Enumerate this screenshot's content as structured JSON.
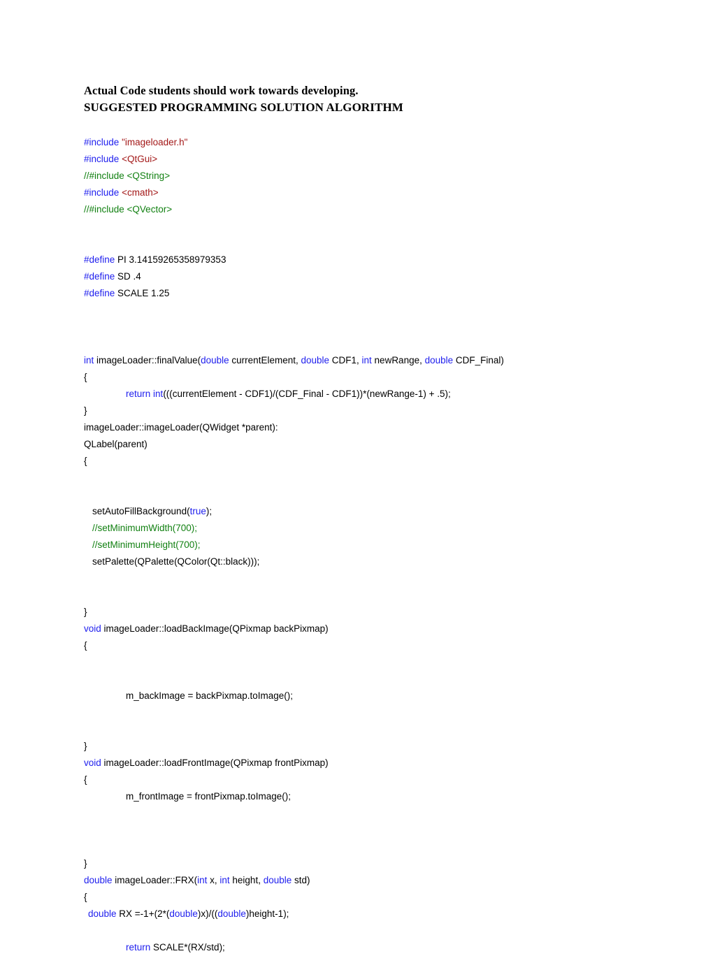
{
  "document": {
    "headings": [
      "Actual Code students should work towards developing.",
      "SUGGESTED PROGRAMMING SOLUTION ALGORITHM"
    ]
  },
  "colors": {
    "keyword": "#2020EE",
    "preprocessor": "#2020EE",
    "string": "#A31818",
    "comment": "#118011",
    "plain": "#000000",
    "background": "#FFFFFF"
  },
  "code": {
    "language": "cpp",
    "lines": [
      {
        "indent": "none",
        "tokens": [
          {
            "t": "#include",
            "c": "pp"
          },
          {
            "t": " ",
            "c": "pl"
          },
          {
            "t": "\"imageloader.h\"",
            "c": "str"
          }
        ]
      },
      {
        "indent": "none",
        "tokens": [
          {
            "t": "#include",
            "c": "pp"
          },
          {
            "t": " ",
            "c": "pl"
          },
          {
            "t": "<QtGui>",
            "c": "str"
          }
        ]
      },
      {
        "indent": "none",
        "tokens": [
          {
            "t": "//#include <QString>",
            "c": "cmt"
          }
        ]
      },
      {
        "indent": "none",
        "tokens": [
          {
            "t": "#include",
            "c": "pp"
          },
          {
            "t": " ",
            "c": "pl"
          },
          {
            "t": "<cmath>",
            "c": "str"
          }
        ]
      },
      {
        "indent": "none",
        "tokens": [
          {
            "t": "//#include <QVector>",
            "c": "cmt"
          }
        ]
      },
      {
        "indent": "none",
        "tokens": []
      },
      {
        "indent": "none",
        "tokens": []
      },
      {
        "indent": "none",
        "tokens": [
          {
            "t": "#define",
            "c": "pp"
          },
          {
            "t": " PI 3.14159265358979353",
            "c": "pl"
          }
        ]
      },
      {
        "indent": "none",
        "tokens": [
          {
            "t": "#define",
            "c": "pp"
          },
          {
            "t": " SD .4",
            "c": "pl"
          }
        ]
      },
      {
        "indent": "none",
        "tokens": [
          {
            "t": "#define",
            "c": "pp"
          },
          {
            "t": " SCALE 1.25",
            "c": "pl"
          }
        ]
      },
      {
        "indent": "none",
        "tokens": []
      },
      {
        "indent": "none",
        "tokens": []
      },
      {
        "indent": "none",
        "tokens": []
      },
      {
        "indent": "none",
        "tokens": [
          {
            "t": "int",
            "c": "kw"
          },
          {
            "t": " imageLoader::finalValue(",
            "c": "pl"
          },
          {
            "t": "double",
            "c": "kw"
          },
          {
            "t": " currentElement, ",
            "c": "pl"
          },
          {
            "t": "double",
            "c": "kw"
          },
          {
            "t": " CDF1, ",
            "c": "pl"
          },
          {
            "t": "int",
            "c": "kw"
          },
          {
            "t": " newRange, ",
            "c": "pl"
          },
          {
            "t": "double",
            "c": "kw"
          },
          {
            "t": " CDF_Final)",
            "c": "pl"
          }
        ]
      },
      {
        "indent": "none",
        "tokens": [
          {
            "t": "{",
            "c": "pl"
          }
        ]
      },
      {
        "indent": "tab",
        "tokens": [
          {
            "t": "return",
            "c": "kw"
          },
          {
            "t": " ",
            "c": "pl"
          },
          {
            "t": "int",
            "c": "kw"
          },
          {
            "t": "(((currentElement - CDF1)/(CDF_Final - CDF1))*(newRange-1) + .5);",
            "c": "pl"
          }
        ]
      },
      {
        "indent": "none",
        "tokens": [
          {
            "t": "}",
            "c": "pl"
          }
        ]
      },
      {
        "indent": "none",
        "tokens": [
          {
            "t": "imageLoader::imageLoader(QWidget *parent):",
            "c": "pl"
          }
        ]
      },
      {
        "indent": "none",
        "tokens": [
          {
            "t": "QLabel(parent)",
            "c": "pl"
          }
        ]
      },
      {
        "indent": "none",
        "tokens": [
          {
            "t": "{",
            "c": "pl"
          }
        ]
      },
      {
        "indent": "none",
        "tokens": []
      },
      {
        "indent": "none",
        "tokens": []
      },
      {
        "indent": "small",
        "tokens": [
          {
            "t": "setAutoFillBackground(",
            "c": "pl"
          },
          {
            "t": "true",
            "c": "kw"
          },
          {
            "t": ");",
            "c": "pl"
          }
        ]
      },
      {
        "indent": "small",
        "tokens": [
          {
            "t": "//setMinimumWidth(700);",
            "c": "cmt"
          }
        ]
      },
      {
        "indent": "small",
        "tokens": [
          {
            "t": "//setMinimumHeight(700);",
            "c": "cmt"
          }
        ]
      },
      {
        "indent": "small",
        "tokens": [
          {
            "t": "setPalette(QPalette(QColor(Qt::black)));",
            "c": "pl"
          }
        ]
      },
      {
        "indent": "none",
        "tokens": []
      },
      {
        "indent": "none",
        "tokens": []
      },
      {
        "indent": "none",
        "tokens": [
          {
            "t": "}",
            "c": "pl"
          }
        ]
      },
      {
        "indent": "none",
        "tokens": [
          {
            "t": "void",
            "c": "kw"
          },
          {
            "t": " imageLoader::loadBackImage(QPixmap backPixmap)",
            "c": "pl"
          }
        ]
      },
      {
        "indent": "none",
        "tokens": [
          {
            "t": "{",
            "c": "pl"
          }
        ]
      },
      {
        "indent": "none",
        "tokens": []
      },
      {
        "indent": "none",
        "tokens": []
      },
      {
        "indent": "tab",
        "tokens": [
          {
            "t": "m_backImage = backPixmap.toImage();",
            "c": "pl"
          }
        ]
      },
      {
        "indent": "none",
        "tokens": []
      },
      {
        "indent": "none",
        "tokens": []
      },
      {
        "indent": "none",
        "tokens": [
          {
            "t": "}",
            "c": "pl"
          }
        ]
      },
      {
        "indent": "none",
        "tokens": [
          {
            "t": "void",
            "c": "kw"
          },
          {
            "t": " imageLoader::loadFrontImage(QPixmap frontPixmap)",
            "c": "pl"
          }
        ]
      },
      {
        "indent": "none",
        "tokens": [
          {
            "t": "{",
            "c": "pl"
          }
        ]
      },
      {
        "indent": "tab",
        "tokens": [
          {
            "t": "m_frontImage = frontPixmap.toImage();",
            "c": "pl"
          }
        ]
      },
      {
        "indent": "none",
        "tokens": []
      },
      {
        "indent": "none",
        "tokens": []
      },
      {
        "indent": "none",
        "tokens": []
      },
      {
        "indent": "none",
        "tokens": [
          {
            "t": "}",
            "c": "pl"
          }
        ]
      },
      {
        "indent": "none",
        "tokens": [
          {
            "t": "double",
            "c": "kw"
          },
          {
            "t": " imageLoader::FRX(",
            "c": "pl"
          },
          {
            "t": "int",
            "c": "kw"
          },
          {
            "t": " x, ",
            "c": "pl"
          },
          {
            "t": "int",
            "c": "kw"
          },
          {
            "t": " height, ",
            "c": "pl"
          },
          {
            "t": "double",
            "c": "kw"
          },
          {
            "t": " std)",
            "c": "pl"
          }
        ]
      },
      {
        "indent": "none",
        "tokens": [
          {
            "t": "{",
            "c": "pl"
          }
        ]
      },
      {
        "indent": "tiny",
        "tokens": [
          {
            "t": "double",
            "c": "kw"
          },
          {
            "t": " RX =-1+(2*(",
            "c": "pl"
          },
          {
            "t": "double",
            "c": "kw"
          },
          {
            "t": ")x)/((",
            "c": "pl"
          },
          {
            "t": "double",
            "c": "kw"
          },
          {
            "t": ")height-1);",
            "c": "pl"
          }
        ]
      },
      {
        "indent": "none",
        "tokens": []
      },
      {
        "indent": "tab",
        "tokens": [
          {
            "t": "return",
            "c": "kw"
          },
          {
            "t": " SCALE*(RX/std);",
            "c": "pl"
          }
        ]
      }
    ]
  }
}
